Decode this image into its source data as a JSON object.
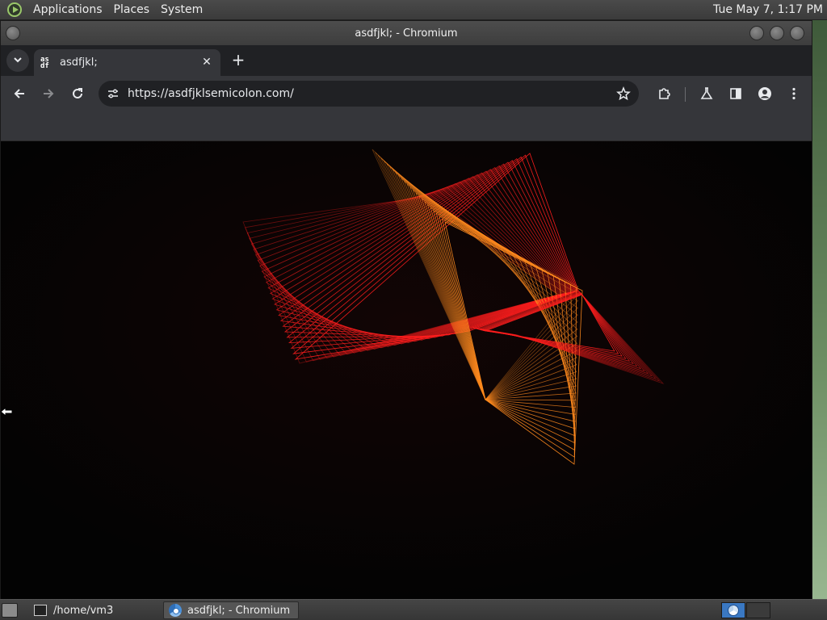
{
  "top_panel": {
    "menus": [
      "Applications",
      "Places",
      "System"
    ],
    "clock": "Tue May 7, 1:17 PM"
  },
  "window": {
    "title": "asdfjkl; - Chromium"
  },
  "browser": {
    "tab": {
      "favicon_text": "as df",
      "title": "asdfjkl;",
      "close_glyph": "✕"
    },
    "new_tab_glyph": "+",
    "tab_search_glyph": "⌄",
    "omnibox": {
      "url": "https://asdfjklsemicolon.com/"
    }
  },
  "taskbar": {
    "tasks": [
      {
        "label": "/home/vm3",
        "icon": "terminal-icon"
      },
      {
        "label": "asdfjkl; - Chromium",
        "icon": "chromium-icon"
      }
    ]
  },
  "page_content": {
    "description_hidden": "",
    "colors": {
      "background": "#030303",
      "line_red": "#ff1e1e",
      "line_orange": "#ff8a1e"
    }
  }
}
